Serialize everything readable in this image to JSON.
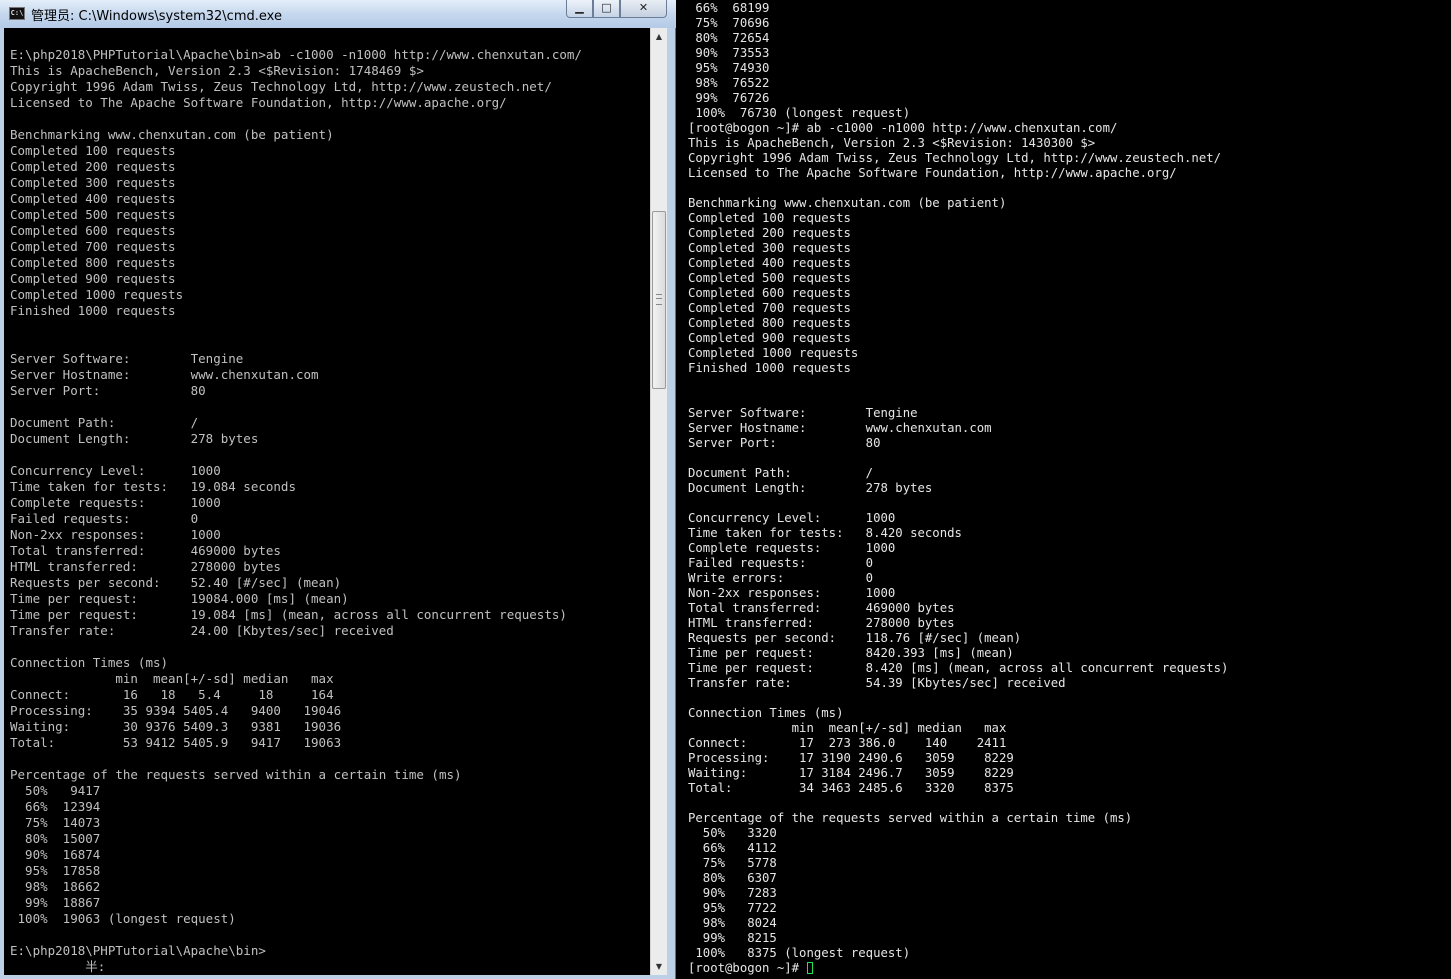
{
  "cmd_window": {
    "title": "管理员: C:\\Windows\\system32\\cmd.exe",
    "icon_label": "C:\\",
    "buttons": {
      "minimize": "▁",
      "maximize": "□",
      "close": "✕"
    },
    "lines": [
      "E:\\php2018\\PHPTutorial\\Apache\\bin>ab -c1000 -n1000 http://www.chenxutan.com/",
      "This is ApacheBench, Version 2.3 <$Revision: 1748469 $>",
      "Copyright 1996 Adam Twiss, Zeus Technology Ltd, http://www.zeustech.net/",
      "Licensed to The Apache Software Foundation, http://www.apache.org/",
      "",
      "Benchmarking www.chenxutan.com (be patient)",
      "Completed 100 requests",
      "Completed 200 requests",
      "Completed 300 requests",
      "Completed 400 requests",
      "Completed 500 requests",
      "Completed 600 requests",
      "Completed 700 requests",
      "Completed 800 requests",
      "Completed 900 requests",
      "Completed 1000 requests",
      "Finished 1000 requests",
      "",
      "",
      "Server Software:        Tengine",
      "Server Hostname:        www.chenxutan.com",
      "Server Port:            80",
      "",
      "Document Path:          /",
      "Document Length:        278 bytes",
      "",
      "Concurrency Level:      1000",
      "Time taken for tests:   19.084 seconds",
      "Complete requests:      1000",
      "Failed requests:        0",
      "Non-2xx responses:      1000",
      "Total transferred:      469000 bytes",
      "HTML transferred:       278000 bytes",
      "Requests per second:    52.40 [#/sec] (mean)",
      "Time per request:       19084.000 [ms] (mean)",
      "Time per request:       19.084 [ms] (mean, across all concurrent requests)",
      "Transfer rate:          24.00 [Kbytes/sec] received",
      "",
      "Connection Times (ms)",
      "              min  mean[+/-sd] median   max",
      "Connect:       16   18   5.4     18     164",
      "Processing:    35 9394 5405.4   9400   19046",
      "Waiting:       30 9376 5409.3   9381   19036",
      "Total:         53 9412 5405.9   9417   19063",
      "",
      "Percentage of the requests served within a certain time (ms)",
      "  50%   9417",
      "  66%  12394",
      "  75%  14073",
      "  80%  15007",
      "  90%  16874",
      "  95%  17858",
      "  98%  18662",
      "  99%  18867",
      " 100%  19063 (longest request)",
      "",
      "E:\\php2018\\PHPTutorial\\Apache\\bin>",
      "          半:"
    ]
  },
  "terminal": {
    "lines": [
      " 66%  68199",
      " 75%  70696",
      " 80%  72654",
      " 90%  73553",
      " 95%  74930",
      " 98%  76522",
      " 99%  76726",
      " 100%  76730 (longest request)",
      "[root@bogon ~]# ab -c1000 -n1000 http://www.chenxutan.com/",
      "This is ApacheBench, Version 2.3 <$Revision: 1430300 $>",
      "Copyright 1996 Adam Twiss, Zeus Technology Ltd, http://www.zeustech.net/",
      "Licensed to The Apache Software Foundation, http://www.apache.org/",
      "",
      "Benchmarking www.chenxutan.com (be patient)",
      "Completed 100 requests",
      "Completed 200 requests",
      "Completed 300 requests",
      "Completed 400 requests",
      "Completed 500 requests",
      "Completed 600 requests",
      "Completed 700 requests",
      "Completed 800 requests",
      "Completed 900 requests",
      "Completed 1000 requests",
      "Finished 1000 requests",
      "",
      "",
      "Server Software:        Tengine",
      "Server Hostname:        www.chenxutan.com",
      "Server Port:            80",
      "",
      "Document Path:          /",
      "Document Length:        278 bytes",
      "",
      "Concurrency Level:      1000",
      "Time taken for tests:   8.420 seconds",
      "Complete requests:      1000",
      "Failed requests:        0",
      "Write errors:           0",
      "Non-2xx responses:      1000",
      "Total transferred:      469000 bytes",
      "HTML transferred:       278000 bytes",
      "Requests per second:    118.76 [#/sec] (mean)",
      "Time per request:       8420.393 [ms] (mean)",
      "Time per request:       8.420 [ms] (mean, across all concurrent requests)",
      "Transfer rate:          54.39 [Kbytes/sec] received",
      "",
      "Connection Times (ms)",
      "              min  mean[+/-sd] median   max",
      "Connect:       17  273 386.0    140    2411",
      "Processing:    17 3190 2490.6   3059    8229",
      "Waiting:       17 3184 2496.7   3059    8229",
      "Total:         34 3463 2485.6   3320    8375",
      "",
      "Percentage of the requests served within a certain time (ms)",
      "  50%   3320",
      "  66%   4112",
      "  75%   5778",
      "  80%   6307",
      "  90%   7283",
      "  95%   7722",
      "  98%   8024",
      "  99%   8215",
      " 100%   8375 (longest request)"
    ],
    "prompt": "[root@bogon ~]# ",
    "cursor_color": "#29e24f"
  }
}
